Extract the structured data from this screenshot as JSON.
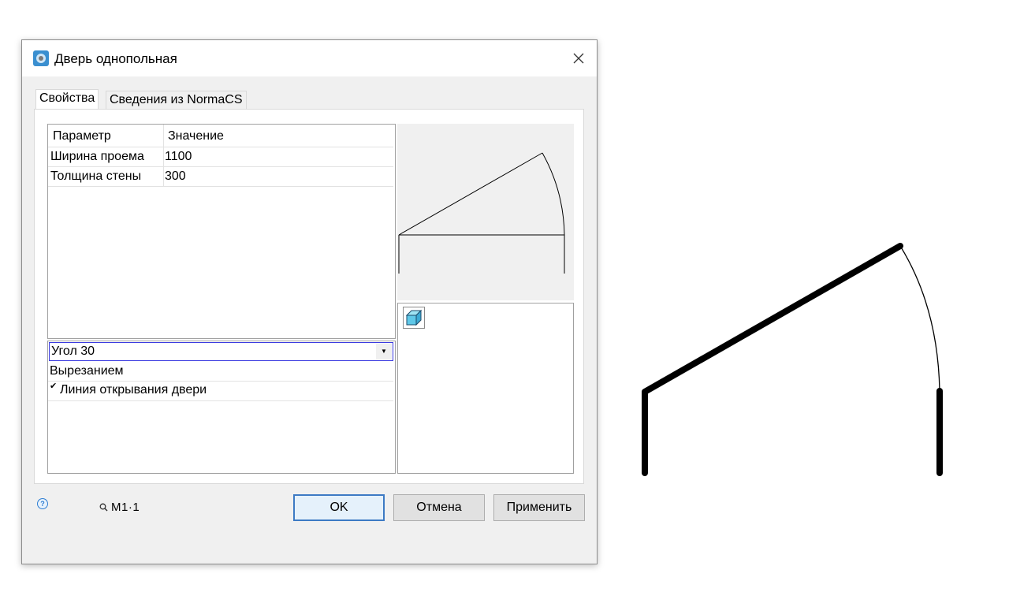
{
  "window": {
    "title": "Дверь однопольная"
  },
  "tabs": [
    {
      "label": "Свойства",
      "active": true
    },
    {
      "label": "Сведения из NormaCS",
      "active": false
    }
  ],
  "params_table": {
    "headers": [
      "Параметр",
      "Значение"
    ],
    "rows": [
      {
        "param": "Ширина проема",
        "value": "1100"
      },
      {
        "param": "Толщина стены",
        "value": "300"
      }
    ]
  },
  "options": {
    "angle_select": "Угол 30",
    "cut_mode": "Вырезанием",
    "door_line_label": "Линия открывания двери",
    "door_line_checked": true
  },
  "footer": {
    "scale_label": "M1·1",
    "ok_label": "OK",
    "cancel_label": "Отмена",
    "apply_label": "Применить"
  },
  "icons": {
    "app": "app-icon",
    "close": "close-icon",
    "help": "help-icon",
    "magnifier": "magnifier-icon",
    "cube": "cube-icon"
  },
  "colors": {
    "dialog_bg": "#f0f0f0",
    "accent_blue": "#3d7ac4",
    "combo_border": "#3c3ce0"
  }
}
